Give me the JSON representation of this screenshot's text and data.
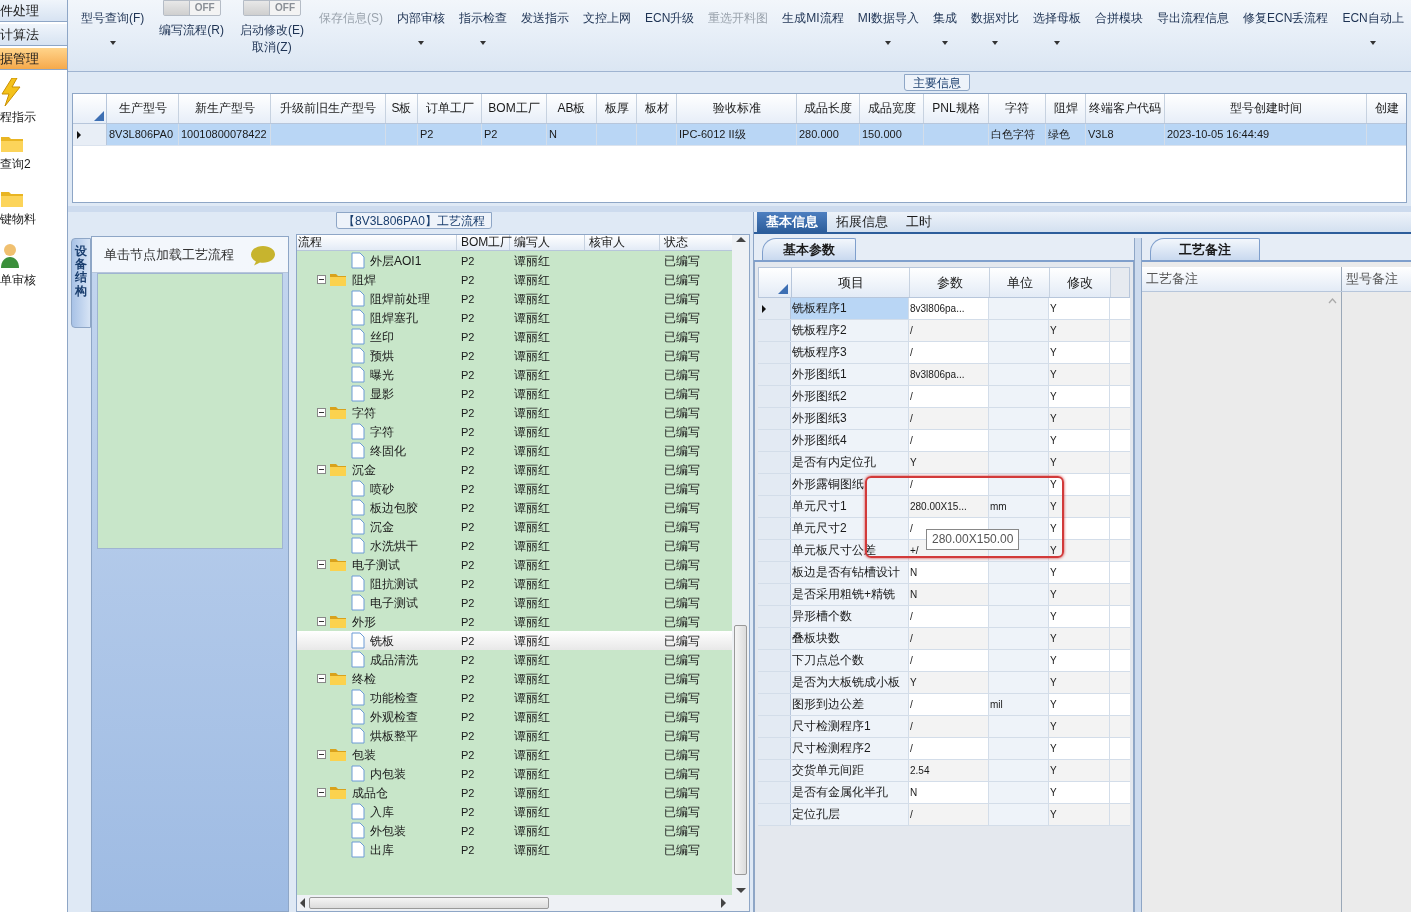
{
  "nav": {
    "menu": [
      {
        "label": "件处理",
        "selected": false
      },
      {
        "label": "计算法",
        "selected": false
      },
      {
        "label": "据管理",
        "selected": true
      }
    ],
    "shortcuts": [
      {
        "label": "程指示",
        "kind": "lightning"
      },
      {
        "label": "查询2",
        "kind": "folder"
      },
      {
        "label": "键物料",
        "kind": "folder"
      },
      {
        "label": "单审核",
        "kind": "person"
      }
    ]
  },
  "toolbar": [
    {
      "kind": "button",
      "label": "型号查询(F)",
      "dropdown": true,
      "disabled": false
    },
    {
      "kind": "toggle",
      "switch": "OFF",
      "on": false,
      "label": "编写流程(R)"
    },
    {
      "kind": "toggle",
      "switch": "OFF",
      "on": false,
      "label": "启动修改(E)",
      "label2": "取消(Z)"
    },
    {
      "kind": "button",
      "label": "保存信息(S)",
      "dropdown": false,
      "disabled": true
    },
    {
      "kind": "button",
      "label": "内部审核",
      "dropdown": true,
      "disabled": false
    },
    {
      "kind": "button",
      "label": "指示检查",
      "dropdown": true,
      "disabled": false
    },
    {
      "kind": "button",
      "label": "发送指示",
      "dropdown": false,
      "disabled": false
    },
    {
      "kind": "button",
      "label": "文控上网",
      "dropdown": false,
      "disabled": false
    },
    {
      "kind": "button",
      "label": "ECN升级",
      "dropdown": false,
      "disabled": false
    },
    {
      "kind": "button",
      "label": "重选开料图",
      "dropdown": false,
      "disabled": true
    },
    {
      "kind": "button",
      "label": "生成MI流程",
      "dropdown": false,
      "disabled": false
    },
    {
      "kind": "button",
      "label": "MI数据导入",
      "dropdown": true,
      "disabled": false
    },
    {
      "kind": "button",
      "label": "集成",
      "dropdown": true,
      "disabled": false
    },
    {
      "kind": "button",
      "label": "数据对比",
      "dropdown": true,
      "disabled": false
    },
    {
      "kind": "button",
      "label": "选择母板",
      "dropdown": true,
      "disabled": false
    },
    {
      "kind": "button",
      "label": "合拼模块",
      "dropdown": false,
      "disabled": false
    },
    {
      "kind": "button",
      "label": "导出流程信息",
      "dropdown": false,
      "disabled": false
    },
    {
      "kind": "button",
      "label": "修复ECN丢流程",
      "dropdown": false,
      "disabled": false
    },
    {
      "kind": "button",
      "label": "ECN自动上",
      "dropdown": true,
      "disabled": false
    }
  ],
  "main_info": {
    "title": "主要信息",
    "columns": [
      "生产型号",
      "新生产型号",
      "升级前旧生产型号",
      "S板",
      "订单工厂",
      "BOM工厂",
      "AB板",
      "板厚",
      "板材",
      "验收标准",
      "成品长度",
      "成品宽度",
      "PNL规格",
      "字符",
      "阻焊",
      "终端客户代码",
      "型号创建时间",
      "创建"
    ],
    "rows": [
      {
        "selected": true,
        "cells": [
          "8V3L806PA0",
          "10010800078422",
          null,
          null,
          "P2",
          "P2",
          "N",
          null,
          null,
          "IPC-6012 II级",
          "280.000",
          "150.000",
          null,
          "白色字符",
          "绿色",
          "V3L8",
          "2023-10-05 16:44:49",
          null
        ]
      }
    ]
  },
  "process": {
    "title": "【8V3L806PA0】工艺流程",
    "side_tab": "设备结构",
    "hint": "单击节点加载工艺流程",
    "columns": [
      "流程",
      "BOM工厂",
      "编写人",
      "核审人",
      "状态"
    ],
    "tree": [
      {
        "name": "外层AOI1",
        "bom": "P2",
        "writer": "谭丽红",
        "status": "已编写",
        "selected": false
      },
      {
        "name": "阻焊",
        "bom": "P2",
        "writer": "谭丽红",
        "status": "已编写",
        "selected": false,
        "children": [
          {
            "name": "阻焊前处理",
            "bom": "P2",
            "writer": "谭丽红",
            "status": "已编写",
            "selected": false
          },
          {
            "name": "阻焊塞孔",
            "bom": "P2",
            "writer": "谭丽红",
            "status": "已编写",
            "selected": false
          },
          {
            "name": "丝印",
            "bom": "P2",
            "writer": "谭丽红",
            "status": "已编写",
            "selected": false
          },
          {
            "name": "预烘",
            "bom": "P2",
            "writer": "谭丽红",
            "status": "已编写",
            "selected": false
          },
          {
            "name": "曝光",
            "bom": "P2",
            "writer": "谭丽红",
            "status": "已编写",
            "selected": false
          },
          {
            "name": "显影",
            "bom": "P2",
            "writer": "谭丽红",
            "status": "已编写",
            "selected": false
          }
        ]
      },
      {
        "name": "字符",
        "bom": "P2",
        "writer": "谭丽红",
        "status": "已编写",
        "selected": false,
        "children": [
          {
            "name": "字符",
            "bom": "P2",
            "writer": "谭丽红",
            "status": "已编写",
            "selected": false
          },
          {
            "name": "终固化",
            "bom": "P2",
            "writer": "谭丽红",
            "status": "已编写",
            "selected": false
          }
        ]
      },
      {
        "name": "沉金",
        "bom": "P2",
        "writer": "谭丽红",
        "status": "已编写",
        "selected": false,
        "children": [
          {
            "name": "喷砂",
            "bom": "P2",
            "writer": "谭丽红",
            "status": "已编写",
            "selected": false
          },
          {
            "name": "板边包胶",
            "bom": "P2",
            "writer": "谭丽红",
            "status": "已编写",
            "selected": false
          },
          {
            "name": "沉金",
            "bom": "P2",
            "writer": "谭丽红",
            "status": "已编写",
            "selected": false
          },
          {
            "name": "水洗烘干",
            "bom": "P2",
            "writer": "谭丽红",
            "status": "已编写",
            "selected": false
          }
        ]
      },
      {
        "name": "电子测试",
        "bom": "P2",
        "writer": "谭丽红",
        "status": "已编写",
        "selected": false,
        "children": [
          {
            "name": "阻抗测试",
            "bom": "P2",
            "writer": "谭丽红",
            "status": "已编写",
            "selected": false
          },
          {
            "name": "电子测试",
            "bom": "P2",
            "writer": "谭丽红",
            "status": "已编写",
            "selected": false
          }
        ]
      },
      {
        "name": "外形",
        "bom": "P2",
        "writer": "谭丽红",
        "status": "已编写",
        "selected": false,
        "children": [
          {
            "name": "铣板",
            "bom": "P2",
            "writer": "谭丽红",
            "status": "已编写",
            "selected": true
          },
          {
            "name": "成品清洗",
            "bom": "P2",
            "writer": "谭丽红",
            "status": "已编写",
            "selected": false
          }
        ]
      },
      {
        "name": "终检",
        "bom": "P2",
        "writer": "谭丽红",
        "status": "已编写",
        "selected": false,
        "children": [
          {
            "name": "功能检查",
            "bom": "P2",
            "writer": "谭丽红",
            "status": "已编写",
            "selected": false
          },
          {
            "name": "外观检查",
            "bom": "P2",
            "writer": "谭丽红",
            "status": "已编写",
            "selected": false
          },
          {
            "name": "烘板整平",
            "bom": "P2",
            "writer": "谭丽红",
            "status": "已编写",
            "selected": false
          }
        ]
      },
      {
        "name": "包装",
        "bom": "P2",
        "writer": "谭丽红",
        "status": "已编写",
        "selected": false,
        "children": [
          {
            "name": "内包装",
            "bom": "P2",
            "writer": "谭丽红",
            "status": "已编写",
            "selected": false
          }
        ]
      },
      {
        "name": "成品仓",
        "bom": "P2",
        "writer": "谭丽红",
        "status": "已编写",
        "selected": false,
        "children": [
          {
            "name": "入库",
            "bom": "P2",
            "writer": "谭丽红",
            "status": "已编写",
            "selected": false
          },
          {
            "name": "外包装",
            "bom": "P2",
            "writer": "谭丽红",
            "status": "已编写",
            "selected": false
          },
          {
            "name": "出库",
            "bom": "P2",
            "writer": "谭丽红",
            "status": "已编写",
            "selected": false
          }
        ]
      }
    ]
  },
  "details": {
    "tabs": [
      {
        "label": "基本信息",
        "selected": true
      },
      {
        "label": "拓展信息",
        "selected": false
      },
      {
        "label": "工时",
        "selected": false
      }
    ],
    "params": {
      "tab": "基本参数",
      "columns": [
        "项目",
        "参数",
        "单位",
        "修改"
      ],
      "rows": [
        {
          "item": "铣板程序1",
          "value": "8v3l806pa...",
          "modify": "Y",
          "selected": true
        },
        {
          "item": "铣板程序2",
          "value": "/",
          "modify": "Y",
          "selected": false
        },
        {
          "item": "铣板程序3",
          "value": "/",
          "modify": "Y",
          "selected": false
        },
        {
          "item": "外形图纸1",
          "value": "8v3l806pa...",
          "modify": "Y",
          "selected": false
        },
        {
          "item": "外形图纸2",
          "value": "/",
          "modify": "Y",
          "selected": false
        },
        {
          "item": "外形图纸3",
          "value": "/",
          "modify": "Y",
          "selected": false
        },
        {
          "item": "外形图纸4",
          "value": "/",
          "modify": "Y",
          "selected": false
        },
        {
          "item": "是否有内定位孔",
          "value": "Y",
          "modify": "Y",
          "selected": false
        },
        {
          "item": "外形露铜图纸",
          "value": "/",
          "modify": "Y",
          "selected": false
        },
        {
          "item": "单元尺寸1",
          "value": "280.00X15...",
          "unit": "mm",
          "modify": "Y",
          "selected": false
        },
        {
          "item": "单元尺寸2",
          "value": "/",
          "modify": "Y",
          "selected": false
        },
        {
          "item": "单元板尺寸公差",
          "value": "+/",
          "modify": "Y",
          "selected": false
        },
        {
          "item": "板边是否有钻槽设计",
          "value": "N",
          "modify": "Y",
          "selected": false
        },
        {
          "item": "是否采用粗铣+精铣",
          "value": "N",
          "modify": "Y",
          "selected": false
        },
        {
          "item": "异形槽个数",
          "value": "/",
          "modify": "Y",
          "selected": false
        },
        {
          "item": "叠板块数",
          "value": "/",
          "modify": "Y",
          "selected": false
        },
        {
          "item": "下刀点总个数",
          "value": "/",
          "modify": "Y",
          "selected": false
        },
        {
          "item": "是否为大板铣成小板",
          "value": "Y",
          "modify": "Y",
          "selected": false
        },
        {
          "item": "图形到边公差",
          "value": "/",
          "unit": "mil",
          "modify": "Y",
          "selected": false
        },
        {
          "item": "尺寸检测程序1",
          "value": "/",
          "modify": "Y",
          "selected": false
        },
        {
          "item": "尺寸检测程序2",
          "value": "/",
          "modify": "Y",
          "selected": false
        },
        {
          "item": "交货单元间距",
          "value": "2.54",
          "modify": "Y",
          "selected": false
        },
        {
          "item": "是否有金属化半孔",
          "value": "N",
          "modify": "Y",
          "selected": false
        },
        {
          "item": "定位孔层",
          "value": "/",
          "modify": "Y",
          "selected": false
        }
      ],
      "tooltip": "280.00X150.00"
    },
    "notes": {
      "tab": "工艺备注",
      "columns": [
        "工艺备注",
        "型号备注"
      ]
    }
  }
}
